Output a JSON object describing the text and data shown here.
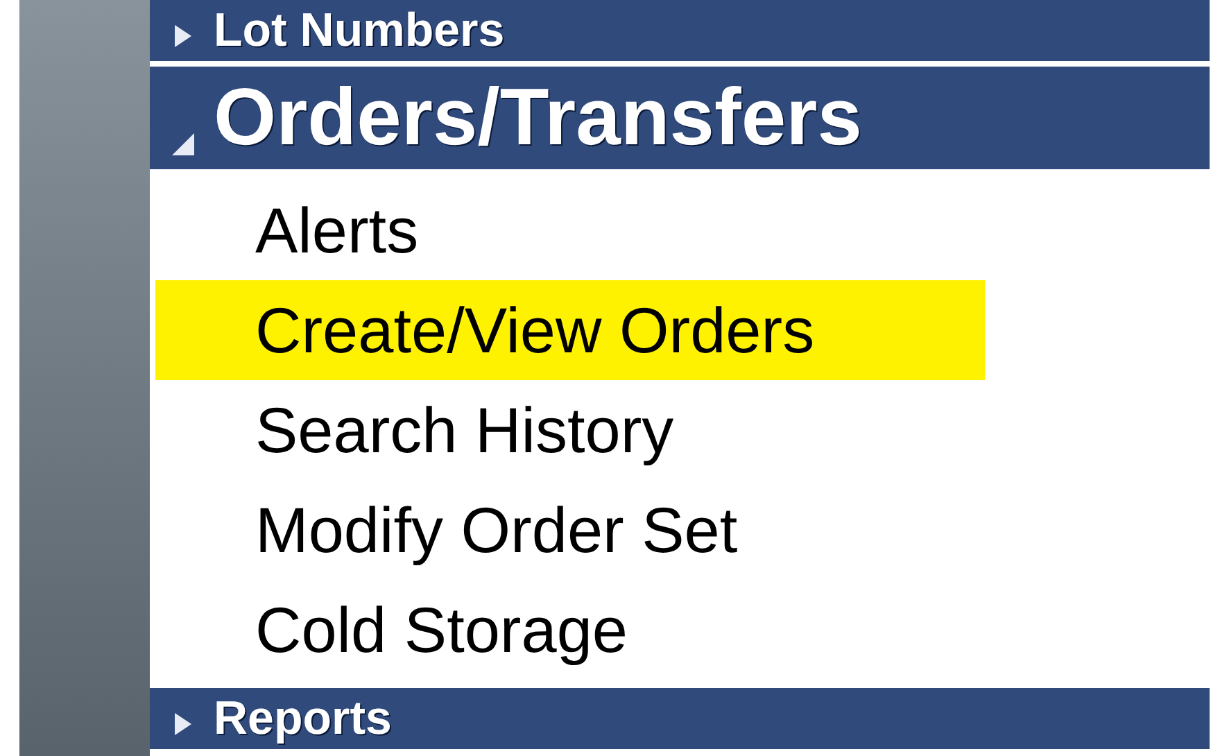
{
  "menu": [
    {
      "label": "Lot Numbers",
      "expanded": false
    },
    {
      "label": "Orders/Transfers",
      "expanded": true,
      "items": [
        {
          "label": "Alerts",
          "selected": false
        },
        {
          "label": "Create/View Orders",
          "selected": true
        },
        {
          "label": "Search History",
          "selected": false
        },
        {
          "label": "Modify Order Set",
          "selected": false
        },
        {
          "label": "Cold Storage",
          "selected": false
        }
      ]
    },
    {
      "label": "Reports",
      "expanded": false
    }
  ]
}
